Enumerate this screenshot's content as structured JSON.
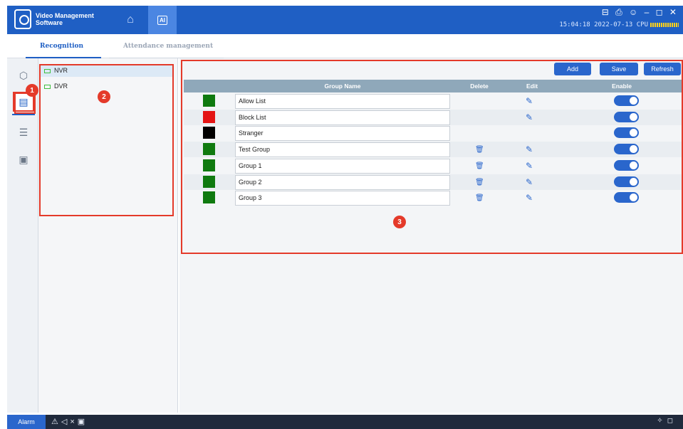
{
  "app": {
    "title_line1": "Video Management",
    "title_line2": "Software",
    "logo_icon": "camera-logo-icon",
    "home_icon": "home-icon",
    "ai_label": "AI"
  },
  "window_controls": [
    "monitor-icon",
    "lock-icon",
    "user-icon",
    "minimize-icon",
    "maximize-icon",
    "close-icon"
  ],
  "window_glyphs": "⊟ ⎙ ☺ – ◻ ✕",
  "status": {
    "time": "15:04:18",
    "date": "2022-07-13",
    "cpu_label": "CPU"
  },
  "tabs": [
    "Recognition",
    "Attendance management"
  ],
  "rail": [
    "box-icon",
    "face-db-icon",
    "list-icon",
    "person-card-icon"
  ],
  "devices": [
    "NVR",
    "DVR"
  ],
  "toolbar": {
    "add": "Add",
    "save": "Save",
    "refresh": "Refresh"
  },
  "columns": {
    "group_name": "Group Name",
    "delete": "Delete",
    "edit": "Edit",
    "enable": "Enable"
  },
  "groups": [
    {
      "name": "Allow List",
      "color": "#0f7a0f",
      "deletable": false,
      "editable": true,
      "enabled": true
    },
    {
      "name": "Block List",
      "color": "#e41414",
      "deletable": false,
      "editable": true,
      "enabled": true
    },
    {
      "name": "Stranger",
      "color": "#000000",
      "deletable": false,
      "editable": false,
      "enabled": true
    },
    {
      "name": "Test Group",
      "color": "#0f7a0f",
      "deletable": true,
      "editable": true,
      "enabled": true
    },
    {
      "name": "Group 1",
      "color": "#0f7a0f",
      "deletable": true,
      "editable": true,
      "enabled": true
    },
    {
      "name": "Group 2",
      "color": "#0f7a0f",
      "deletable": true,
      "editable": true,
      "enabled": true
    },
    {
      "name": "Group 3",
      "color": "#0f7a0f",
      "deletable": true,
      "editable": true,
      "enabled": true
    }
  ],
  "callouts": [
    "1",
    "2",
    "3"
  ],
  "bottom": {
    "alarm": "Alarm"
  },
  "colors": {
    "primary": "#1f5fc4",
    "annotation": "#e43a2a"
  }
}
